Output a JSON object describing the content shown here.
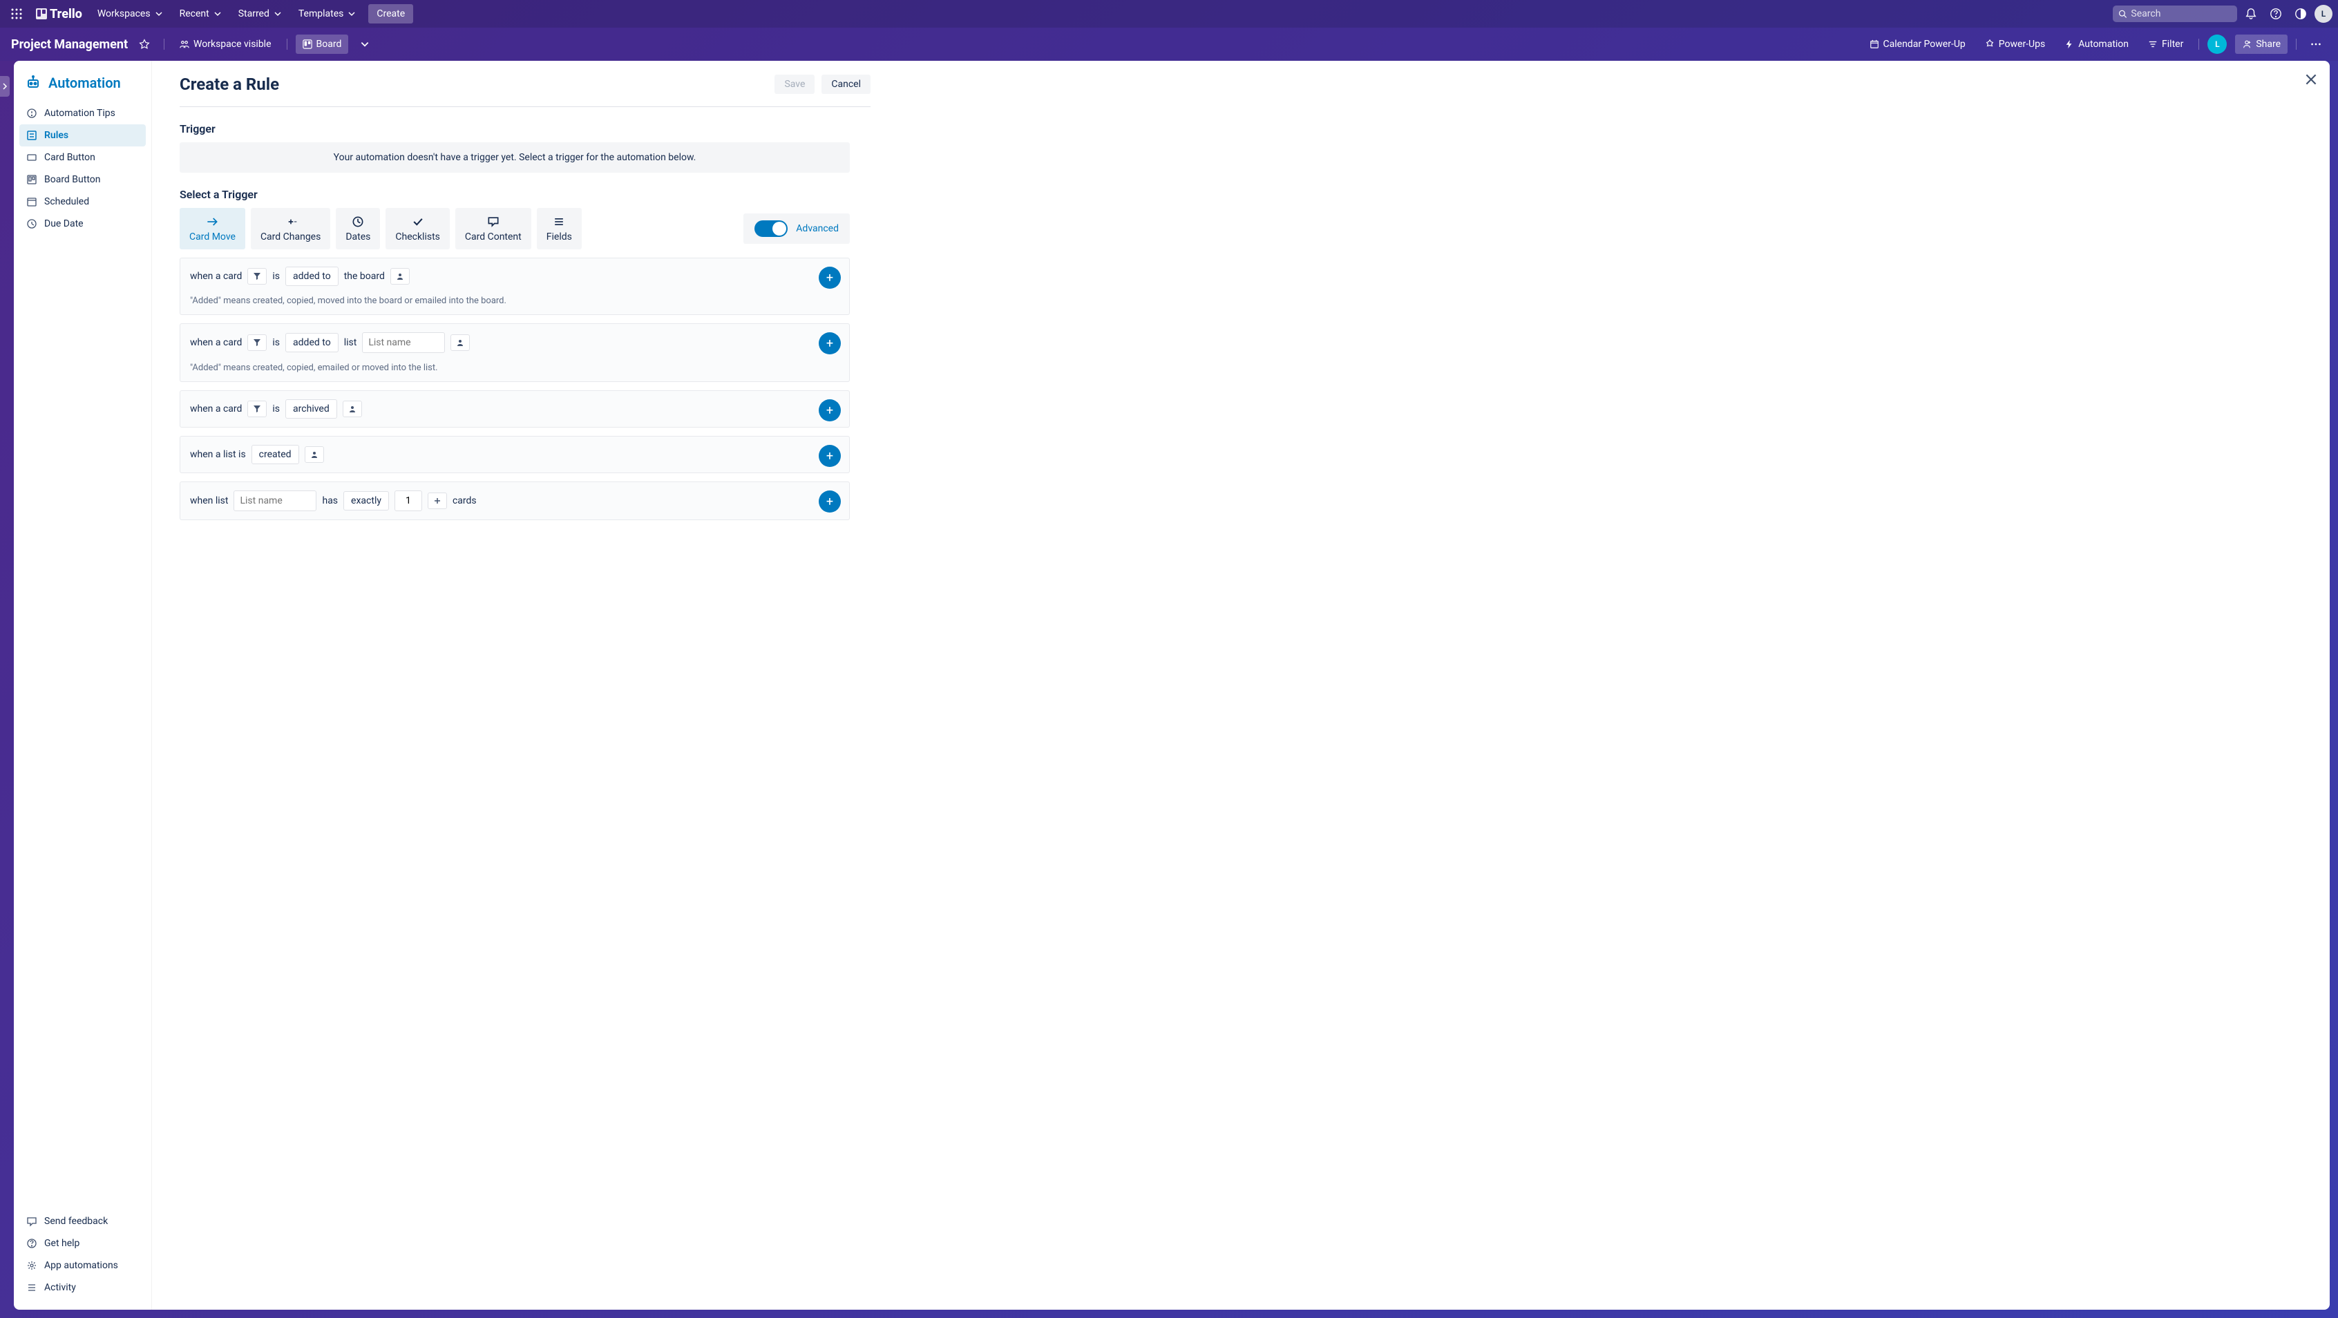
{
  "topbar": {
    "logo": "Trello",
    "nav": [
      "Workspaces",
      "Recent",
      "Starred",
      "Templates"
    ],
    "create": "Create",
    "search_placeholder": "Search",
    "avatar_initial": "L"
  },
  "boardbar": {
    "name": "Project Management",
    "workspace_visible": "Workspace visible",
    "board": "Board",
    "calendar": "Calendar Power-Up",
    "powerups": "Power-Ups",
    "automation": "Automation",
    "filter": "Filter",
    "share": "Share",
    "member_initial": "L"
  },
  "sidebar": {
    "title": "Automation",
    "items": [
      {
        "label": "Automation Tips"
      },
      {
        "label": "Rules"
      },
      {
        "label": "Card Button"
      },
      {
        "label": "Board Button"
      },
      {
        "label": "Scheduled"
      },
      {
        "label": "Due Date"
      }
    ],
    "bottom": [
      {
        "label": "Send feedback"
      },
      {
        "label": "Get help"
      },
      {
        "label": "App automations"
      },
      {
        "label": "Activity"
      }
    ]
  },
  "page": {
    "title": "Create a Rule",
    "save": "Save",
    "cancel": "Cancel",
    "trigger_label": "Trigger",
    "empty_msg": "Your automation doesn't have a trigger yet. Select a trigger for the automation below.",
    "select_label": "Select a Trigger",
    "tabs": [
      "Card Move",
      "Card Changes",
      "Dates",
      "Checklists",
      "Card Content",
      "Fields"
    ],
    "advanced": "Advanced"
  },
  "triggers": {
    "t1": {
      "prefix": "when a card",
      "is": "is",
      "action": "added to",
      "target": "the board",
      "hint": "\"Added\" means created, copied, moved into the board or emailed into the board."
    },
    "t2": {
      "prefix": "when a card",
      "is": "is",
      "action": "added to",
      "list": "list",
      "placeholder": "List name",
      "hint": "\"Added\" means created, copied, emailed or moved into the list."
    },
    "t3": {
      "prefix": "when a card",
      "is": "is",
      "action": "archived"
    },
    "t4": {
      "prefix": "when a list is",
      "action": "created"
    },
    "t5": {
      "prefix": "when list",
      "placeholder": "List name",
      "has": "has",
      "exactly": "exactly",
      "value": "1",
      "cards": "cards"
    }
  }
}
